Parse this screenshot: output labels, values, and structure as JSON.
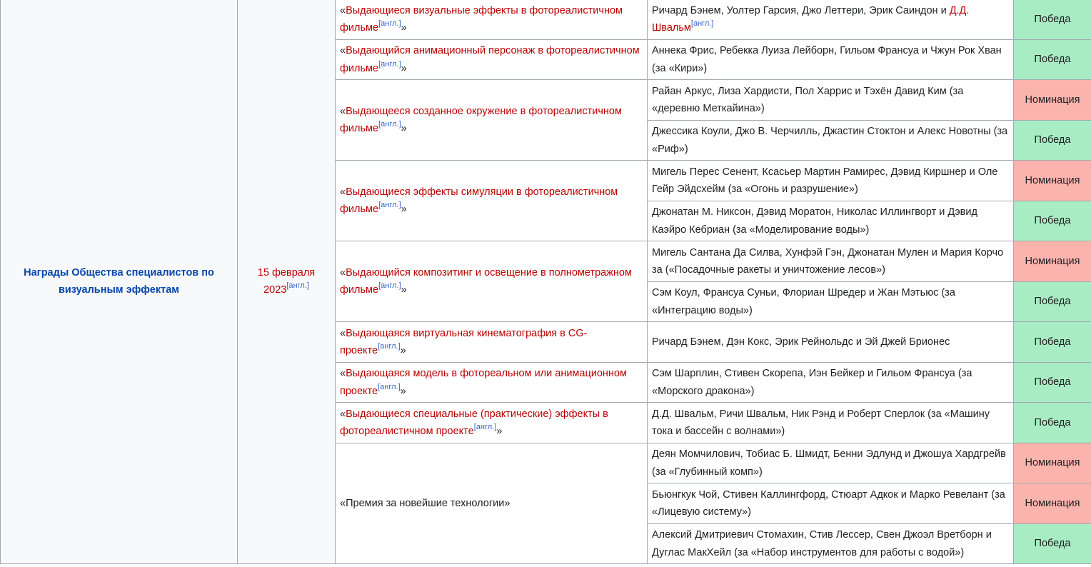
{
  "organization": "Награды Общества специалистов по визуальным эффектам",
  "date": "15 февраля 2023",
  "ref_label": "[англ.]",
  "quote_open": "«",
  "quote_close": "»",
  "result_labels": {
    "win": "Победа",
    "nom": "Номинация"
  },
  "categories": [
    {
      "name": "Выдающиеся визуальные эффекты в фотореалистичном фильме",
      "link": true,
      "entries": [
        {
          "pre": "Ричард Бэнем, Уолтер Гарсия, Джо Леттери, Эрик Саиндон и ",
          "link": "Д.Д. Швальм",
          "ref": true,
          "post": "",
          "result": "Победа",
          "win": true
        }
      ]
    },
    {
      "name": "Выдающийся анимационный персонаж в фотореалистичном фильме",
      "link": true,
      "entries": [
        {
          "pre": "Аннека Фрис, Ребекка Луиза Лейборн, Гильом Франсуа и Чжун Рок Хван (за «Кири»)",
          "result": "Победа",
          "win": true
        }
      ]
    },
    {
      "name": "Выдающееся созданное окружение в фотореалистичном фильме",
      "link": true,
      "entries": [
        {
          "pre": "Райан Аркус, Лиза Хардисти, Пол Харрис и Тэхён Давид Ким (за «деревню Меткайина»)",
          "result": "Номинация",
          "win": false
        },
        {
          "pre": "Джессика Коули, Джо В. Черчилль, Джастин Стоктон и Алекс Новотны (за «Риф»)",
          "result": "Победа",
          "win": true
        }
      ]
    },
    {
      "name": "Выдающиеся эффекты симуляции в фотореалистичном фильме",
      "link": true,
      "entries": [
        {
          "pre": "Мигель Перес Сенент, Ксасьер Мартин Рамирес, Дэвид Киршнер и Оле Гейр Эйдсхейм (за «Огонь и разрушение»)",
          "result": "Номинация",
          "win": false
        },
        {
          "pre": "Джонатан М. Никсон, Дэвид Моратон, Николас Иллингворт и Дэвид Каэйро Кебриан (за «Моделирование воды»)",
          "result": "Победа",
          "win": true
        }
      ]
    },
    {
      "name": "Выдающийся композитинг и освещение в полнометражном фильме",
      "link": true,
      "entries": [
        {
          "pre": "Мигель Сантана Да Силва, Хунфэй Гэн, Джонатан Мулен и Мария Корчо за («Посадочные ракеты и уничтожение лесов»)",
          "result": "Номинация",
          "win": false
        },
        {
          "pre": "Сэм Коул, Франсуа Суньи, Флориан Шредер и Жан Мэтьюс (за «Интеграцию воды»)",
          "result": "Победа",
          "win": true
        }
      ]
    },
    {
      "name": "Выдающаяся виртуальная кинематография в CG-проекте",
      "link": true,
      "entries": [
        {
          "pre": "Ричард Бэнем, Дэн Кокс, Эрик Рейнольдс и Эй Джей Брионес",
          "result": "Победа",
          "win": true
        }
      ]
    },
    {
      "name": "Выдающаяся модель в фотореальном или анимационном проекте",
      "link": true,
      "entries": [
        {
          "pre": "Сэм Шарплин, Стивен Скорепа, Иэн Бейкер и Гильом Франсуа (за «Морского дракона»)",
          "result": "Победа",
          "win": true
        }
      ]
    },
    {
      "name": "Выдающиеся специальные (практические) эффекты в фотореалистичном проекте",
      "link": true,
      "entries": [
        {
          "pre": "Д.Д. Швальм, Ричи Швальм, Ник Рэнд и Роберт Сперлок (за «Машину тока и бассейн с волнами»)",
          "result": "Победа",
          "win": true
        }
      ]
    },
    {
      "name": "Премия за новейшие технологии",
      "link": false,
      "entries": [
        {
          "pre": "Деян Момчилович, Тобиас Б. Шмидт, Бенни Эдлунд и Джошуа Хардгрейв (за «Глубинный комп»)",
          "result": "Номинация",
          "win": false
        },
        {
          "pre": "Бьюнгкук Чой, Стивен Каллингфорд, Стюарт Адкок и Марко Ревелант (за «Лицевую систему»)",
          "result": "Номинация",
          "win": false
        },
        {
          "pre": "Алексий Дмитриевич Стомахин, Стив Лессер, Свен Джоэл Вретборн и Дуглас МакХейл (за «Набор инструментов для работы с водой»)",
          "result": "Победа",
          "win": true
        }
      ]
    }
  ]
}
